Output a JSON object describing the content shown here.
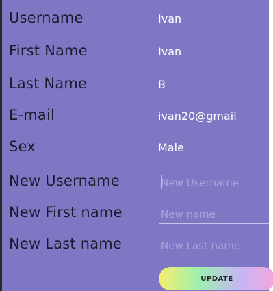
{
  "profile": {
    "fields": [
      {
        "label": "Username",
        "value": "Ivan"
      },
      {
        "label": "First Name",
        "value": "Ivan"
      },
      {
        "label": "Last Name",
        "value": "B"
      },
      {
        "label": "E-mail",
        "value": "ivan20@gmail"
      },
      {
        "label": "Sex",
        "value": "Male"
      }
    ]
  },
  "edit": {
    "fields": [
      {
        "label": "New Username",
        "placeholder": "New Username",
        "value": ""
      },
      {
        "label": "New First name",
        "placeholder": "New name",
        "value": ""
      },
      {
        "label": "New Last name",
        "placeholder": "New Last name",
        "value": ""
      }
    ],
    "update_label": "UPDATE"
  },
  "colors": {
    "background": "#7e78c4",
    "label_text": "#1c1a2e",
    "value_text": "#ffffff",
    "focus_underline": "#5ee2d8"
  }
}
